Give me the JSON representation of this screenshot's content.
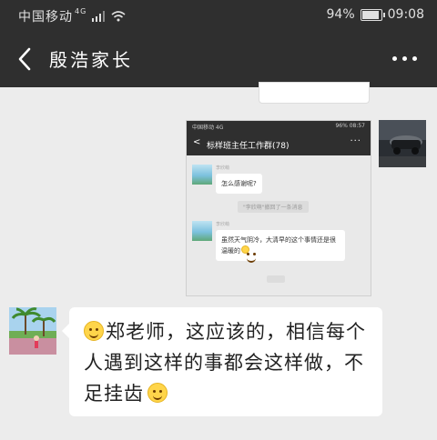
{
  "status_bar": {
    "carrier": "中国移动",
    "network": "4G",
    "battery": "94%",
    "battery_level": 0.94,
    "time": "09:08"
  },
  "nav": {
    "title": "殷浩家长"
  },
  "screenshot_message": {
    "status_left": "中国移动 4G",
    "status_right": "96% 08:57",
    "title": "标样班主任工作群(78)",
    "sender1": "李欣萌",
    "msg1": "怎么感谢呢?",
    "system_msg": "\"李欣萌\"撤回了一条消息",
    "sender2": "李欣萌",
    "msg2": "虽然天气阴冷，大清早的这个事情还是很温暖的"
  },
  "reply_message": {
    "text_part1": "郑老师，这应该的，相信每个人遇到这样的事都会这样做，不足挂齿"
  }
}
